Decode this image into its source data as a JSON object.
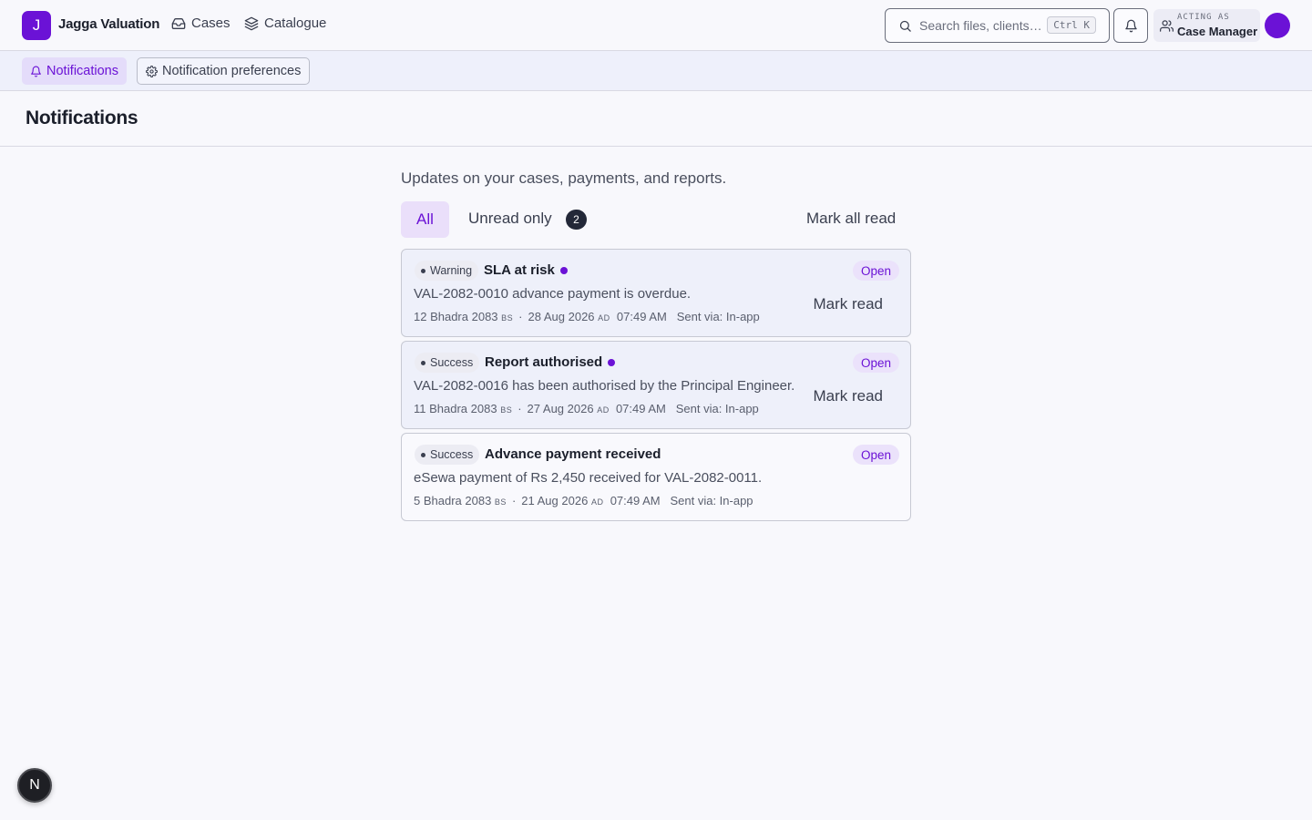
{
  "header": {
    "logo_letter": "J",
    "brand": "Jagga Valuation",
    "nav": [
      {
        "label": "Cases",
        "icon": "inbox-icon"
      },
      {
        "label": "Catalogue",
        "icon": "layers-icon"
      }
    ],
    "search_placeholder": "Search files, clients…",
    "search_shortcut": "Ctrl K",
    "acting_as_label": "ACTING AS",
    "acting_role": "Case Manager"
  },
  "subnav": {
    "notifications_label": "Notifications",
    "preferences_label": "Notification preferences"
  },
  "page": {
    "title": "Notifications",
    "subtitle": "Updates on your cases, payments, and reports.",
    "filter_all": "All",
    "filter_unread": "Unread only",
    "unread_count": "2",
    "mark_all_read": "Mark all read"
  },
  "notifications": [
    {
      "type": "Warning",
      "title": "SLA at risk",
      "unread": true,
      "status": "Open",
      "body": "VAL-2082-0010 advance payment is overdue.",
      "bs_date": "12 Bhadra 2083",
      "bs_era": "BS",
      "ad_date": "28 Aug 2026",
      "ad_era": "AD",
      "time": "07:49 AM",
      "channel": "Sent via: In-app",
      "action": "Mark read"
    },
    {
      "type": "Success",
      "title": "Report authorised",
      "unread": true,
      "status": "Open",
      "body": "VAL-2082-0016 has been authorised by the Principal Engineer.",
      "bs_date": "11 Bhadra 2083",
      "bs_era": "BS",
      "ad_date": "27 Aug 2026",
      "ad_era": "AD",
      "time": "07:49 AM",
      "channel": "Sent via: In-app",
      "action": "Mark read"
    },
    {
      "type": "Success",
      "title": "Advance payment received",
      "unread": false,
      "status": "Open",
      "body": "eSewa payment of Rs 2,450 received for VAL-2082-0011.",
      "bs_date": "5 Bhadra 2083",
      "bs_era": "BS",
      "ad_date": "21 Aug 2026",
      "ad_era": "AD",
      "time": "07:49 AM",
      "channel": "Sent via: In-app"
    }
  ],
  "dev_badge_letter": "N",
  "colors": {
    "accent": "#6b12d6",
    "background": "#f8f8fc",
    "unread_card": "#eef0fa"
  }
}
